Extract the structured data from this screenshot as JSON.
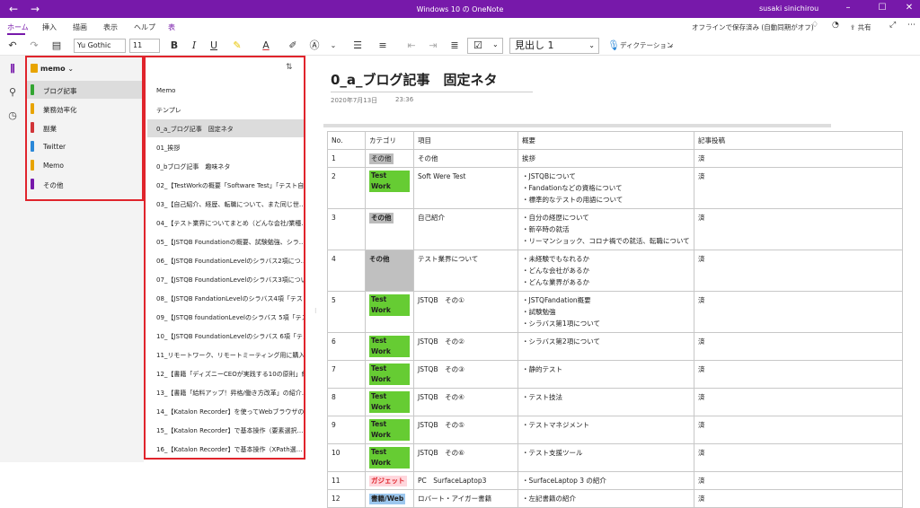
{
  "window": {
    "title": "Windows 10 の OneNote",
    "user": "susaki sinichirou"
  },
  "menu": {
    "tabs": [
      "ホーム",
      "挿入",
      "描画",
      "表示",
      "ヘルプ",
      "表"
    ],
    "status": "オフラインで保存済み (自動同期がオフ)",
    "share": "共有"
  },
  "toolbar": {
    "font_name": "Yu Gothic",
    "font_size": "11",
    "style": "見出し 1",
    "dictation": "ディクテーション"
  },
  "notebook": {
    "name": "memo",
    "sections": [
      {
        "label": "ブログ記事",
        "color": "#33a532"
      },
      {
        "label": "業務効率化",
        "color": "#e8a400"
      },
      {
        "label": "副業",
        "color": "#d13438"
      },
      {
        "label": "Twitter",
        "color": "#2b88d8"
      },
      {
        "label": "Memo",
        "color": "#e8a400"
      },
      {
        "label": "その他",
        "color": "#7719aa"
      }
    ]
  },
  "pages": [
    "Memo",
    "テンプレ",
    "0_a_ブログ記事　固定ネタ",
    "01_挨拶",
    "0_bブログ記事　趣味ネタ",
    "02_【TestWorkの概要「Software Test」「テスト自…",
    "03_【自己紹介、経歴、転職について、また同じ世…",
    "04_【テスト業界についてまとめ（どんな会社/業種…",
    "05_【JSTQB Foundationの概要、試験勉強、シラ…",
    "06_【JSTQB FoundationLevelのシラバス2項につ…",
    "07_【JSTQB FoundationLevelのシラバス3項につい…",
    "08_【JSTQB FandationLevelのシラバス4項「テスト…",
    "09_【JSTQB foundationLevelのシラバス 5項「テス…",
    "10_【JSTQB FoundationLevelのシラバス 6項「テス…",
    "11_リモートワーク、リモートミーティング用に購入した/…",
    "12_【書籍「ディズニーCEOが実践する10の原則」紹…",
    "13_【書籍「給料アップ！昇格/働き方改革」の紹介…",
    "14_【Katalon Recorder】を使ってWebブラウザのテ…",
    "15_【Katalon Recorder】で基本操作（要素選択…",
    "16_【Katalon Recorder】で基本操作（XPath選…"
  ],
  "page": {
    "title": "0_a_ブログ記事　固定ネタ",
    "date": "2020年7月13日",
    "time": "23:36"
  },
  "table": {
    "headers": [
      "No.",
      "カテゴリ",
      "項目",
      "概要",
      "記事投稿"
    ],
    "rows": [
      {
        "no": "1",
        "cat": "その他",
        "cat_style": "gray",
        "item": "その他",
        "summary": [
          "挨拶"
        ],
        "posted": "済"
      },
      {
        "no": "2",
        "cat": "Test Work",
        "cat_style": "green",
        "item": "Soft Were Test",
        "summary": [
          "・JSTQBについて",
          "・Fandationなどの資格について",
          "・標準的なテストの用語について"
        ],
        "posted": "済"
      },
      {
        "no": "3",
        "cat": "その他",
        "cat_style": "graybold",
        "item": "自己紹介",
        "summary": [
          "・自分の経歴について",
          "・新卒時の就活",
          "・リーマンショック、コロナ禍での就活、転職について"
        ],
        "posted": "済"
      },
      {
        "no": "4",
        "cat": "その他",
        "cat_style": "graycell",
        "item": "テスト業界について",
        "summary": [
          "・未経験でもなれるか",
          "・どんな会社があるか",
          "・どんな業界があるか"
        ],
        "posted": "済"
      },
      {
        "no": "5",
        "cat": "Test Work",
        "cat_style": "green",
        "item": "JSTQB　その①",
        "summary": [
          "・JSTQFandation概要",
          "・試験勉強",
          "・シラバス第1項について"
        ],
        "posted": "済"
      },
      {
        "no": "6",
        "cat": "Test Work",
        "cat_style": "green",
        "item": "JSTQB　その②",
        "summary": [
          "・シラバス第2項について"
        ],
        "posted": "済"
      },
      {
        "no": "7",
        "cat": "Test Work",
        "cat_style": "green",
        "item": "JSTQB　その③",
        "summary": [
          "・静的テスト"
        ],
        "posted": "済"
      },
      {
        "no": "8",
        "cat": "Test Work",
        "cat_style": "green",
        "item": "JSTQB　その④",
        "summary": [
          "・テスト技法"
        ],
        "posted": "済"
      },
      {
        "no": "9",
        "cat": "Test Work",
        "cat_style": "green",
        "item": "JSTQB　その⑤",
        "summary": [
          "・テストマネジメント"
        ],
        "posted": "済"
      },
      {
        "no": "10",
        "cat": "Test Work",
        "cat_style": "green",
        "item": "JSTQB　その⑥",
        "summary": [
          "・テスト支援ツール"
        ],
        "posted": "済"
      },
      {
        "no": "11",
        "cat": "ガジェット",
        "cat_style": "pink",
        "item": "PC　SurfaceLaptop3",
        "summary": [
          "・SurfaceLaptop 3 の紹介"
        ],
        "posted": "済"
      },
      {
        "no": "12",
        "cat": "書籍/Web",
        "cat_style": "blue",
        "item": "ロバート・アイガー書籍",
        "summary": [
          "・左記書籍の紹介"
        ],
        "posted": "済"
      }
    ]
  },
  "colors": {
    "brand": "#7719aa",
    "highlight_red": "#e0242c"
  }
}
